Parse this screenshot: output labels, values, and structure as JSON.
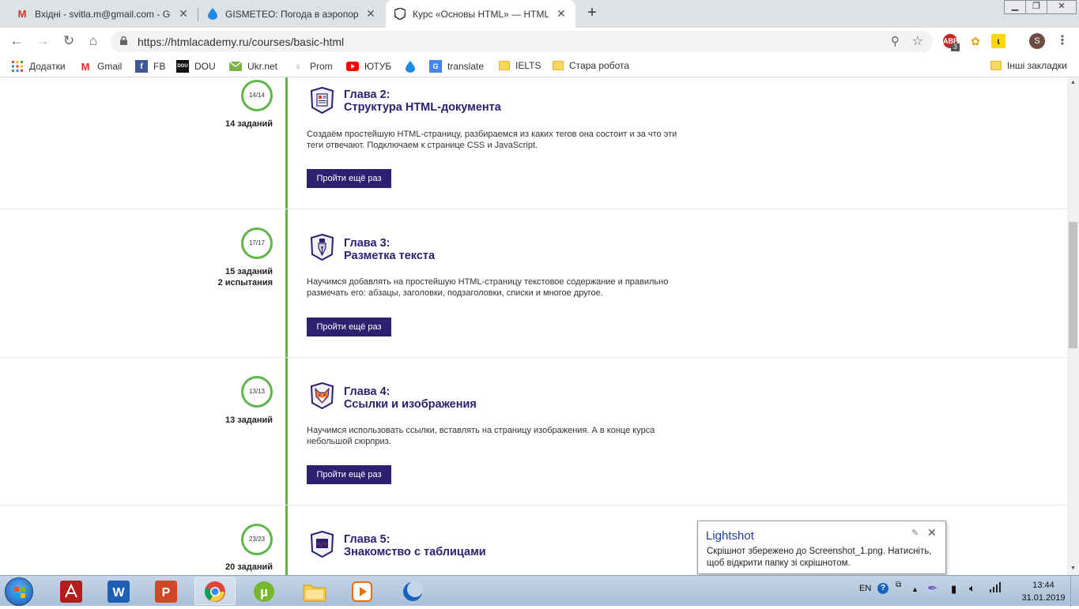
{
  "browser": {
    "tabs": [
      {
        "title": "Вхідні - svitla.m@gmail.com - Gm",
        "icon": "gmail-icon"
      },
      {
        "title": "GISMETEO: Погода в аэропорту",
        "icon": "gismeteo-icon"
      },
      {
        "title": "Курс «Основы HTML» — HTML Ac",
        "icon": "htmlacademy-icon",
        "active": true
      }
    ],
    "url": "https://htmlacademy.ru/courses/basic-html",
    "profile_initial": "S",
    "ext_badge": "3",
    "bookmarks": [
      {
        "label": "Додатки",
        "icon": "apps-icon"
      },
      {
        "label": "Gmail",
        "icon": "gmail-icon"
      },
      {
        "label": "FB",
        "icon": "facebook-icon"
      },
      {
        "label": "DOU",
        "icon": "dou-icon"
      },
      {
        "label": "Ukr.net",
        "icon": "ukrnet-icon"
      },
      {
        "label": "Prom",
        "icon": "prom-icon"
      },
      {
        "label": "ЮТУБ",
        "icon": "youtube-icon"
      },
      {
        "label": "",
        "icon": "gismeteo-icon"
      },
      {
        "label": "translate",
        "icon": "translate-icon"
      },
      {
        "label": "IELTS",
        "icon": "folder-icon"
      },
      {
        "label": "Стара робота",
        "icon": "folder-icon"
      }
    ],
    "other_bookmarks": "Інші закладки"
  },
  "chapters": [
    {
      "progress": "14/14",
      "tasks": "14 заданий",
      "tests": "",
      "title_line1": "Глава 2:",
      "title_line2": "Структура HTML-документа",
      "description": "Создаём простейшую HTML-страницу, разбираемся из каких тегов она состоит и за что эти теги отвечают. Подключаем к странице CSS и JavaScript.",
      "button": "Пройти ещё раз"
    },
    {
      "progress": "17/17",
      "tasks": "15 заданий",
      "tests": "2 испытания",
      "title_line1": "Глава 3:",
      "title_line2": "Разметка текста",
      "description": "Научимся добавлять на простейшую HTML-страницу текстовое содержание и правильно размечать его: абзацы, заголовки, подзаголовки, списки и многое другое.",
      "button": "Пройти ещё раз"
    },
    {
      "progress": "13/13",
      "tasks": "13 заданий",
      "tests": "",
      "title_line1": "Глава 4:",
      "title_line2": "Ссылки и изображения",
      "description": "Научимся использовать ссылки, вставлять на страницу изображения. А в конце курса небольшой сюрприз.",
      "button": "Пройти ещё раз"
    },
    {
      "progress": "23/23",
      "tasks": "20 заданий",
      "tests": "",
      "title_line1": "Глава 5:",
      "title_line2": "Знакомство с таблицами",
      "description": "",
      "button": ""
    }
  ],
  "lightshot": {
    "title": "Lightshot",
    "message": "Скрішнот збережено до Screenshot_1.png. Натисніть, щоб відкрити папку зі скрішнотом."
  },
  "taskbar": {
    "lang": "EN",
    "time": "13:44",
    "date": "31.01.2019"
  },
  "colors": {
    "accent": "#2c2170",
    "timeline": "#61b54a"
  }
}
